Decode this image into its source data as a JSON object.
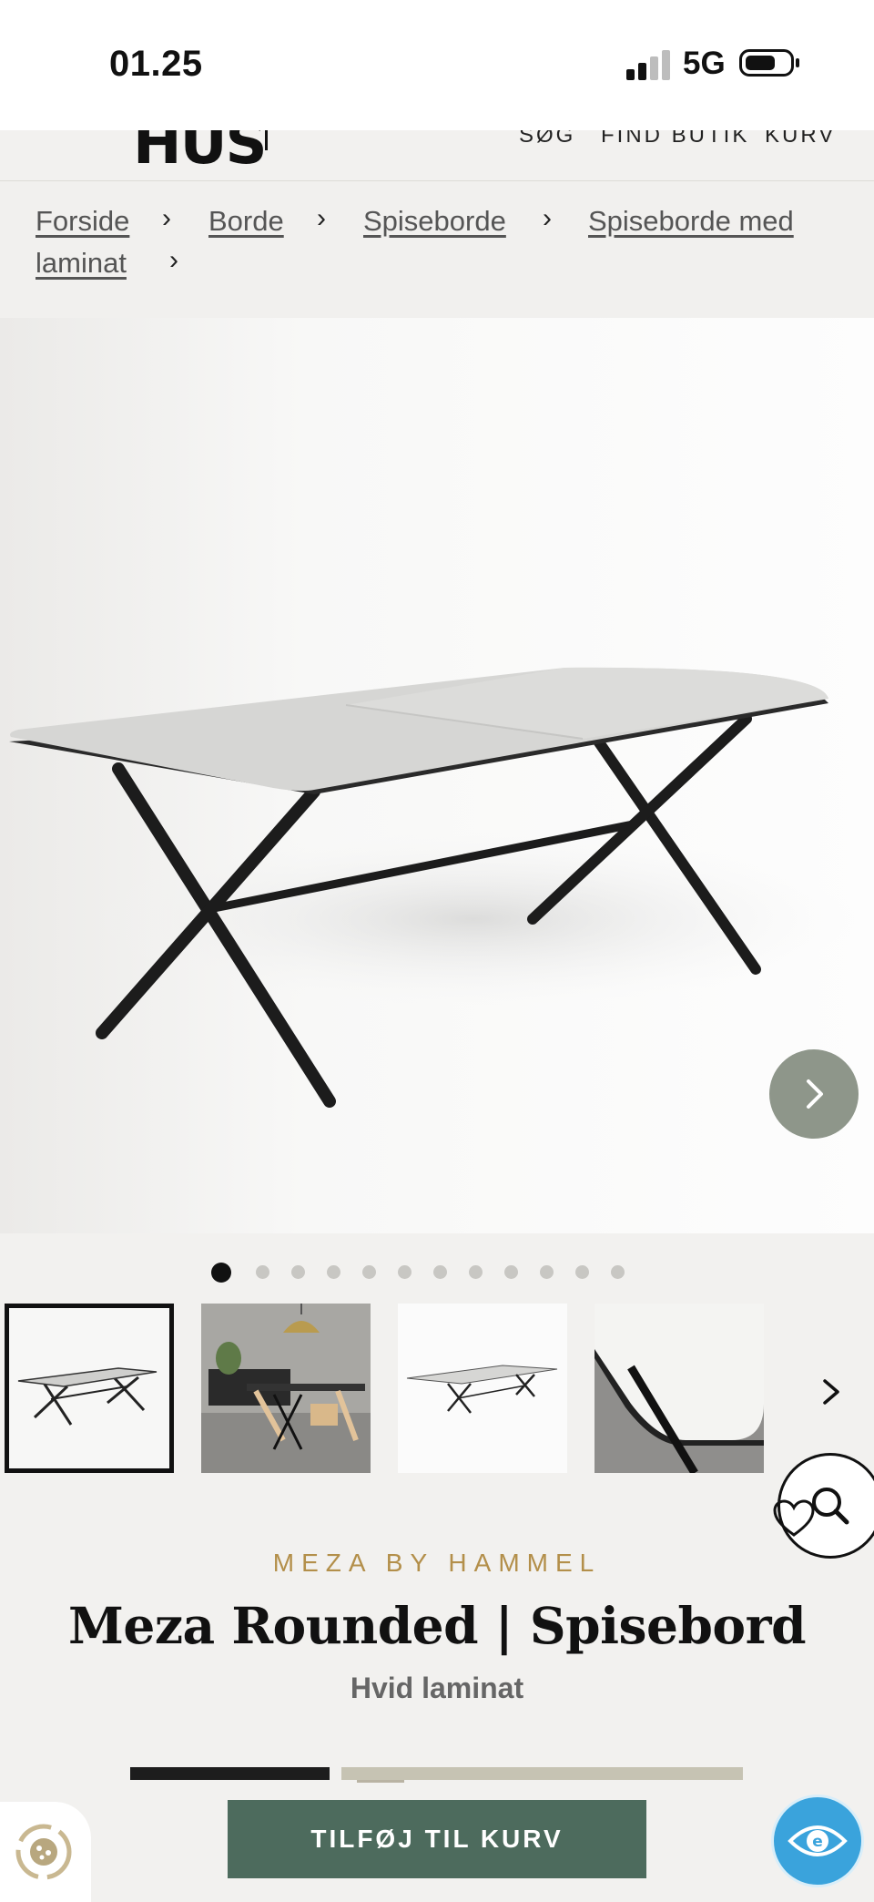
{
  "status_bar": {
    "time": "01.25",
    "network": "5G"
  },
  "header": {
    "logo": "HUS",
    "links": [
      "SØG",
      "FIND BUTIK",
      "KURV"
    ]
  },
  "breadcrumb": [
    "Forside",
    "Borde",
    "Spiseborde",
    "Spiseborde med laminat"
  ],
  "breadcrumb_lines": {
    "line2": "laminat",
    "line1_last": "Spiseborde med"
  },
  "gallery": {
    "image_count": 12,
    "active_index": 0,
    "thumbnails": [
      "table-front-white",
      "dining-room-scene",
      "table-extended",
      "corner-closeup"
    ]
  },
  "product": {
    "brand": "MEZA BY HAMMEL",
    "title": "Meza Rounded | Spisebord",
    "variant": "Hvid laminat",
    "swatch_colors": [
      "#1d1d1d",
      "#c6c3b3"
    ]
  },
  "actions": {
    "add_to_cart": "TILFØJ TIL KURV"
  },
  "colors": {
    "accent_green": "#4d6b5d",
    "brand_gold": "#b38f4a",
    "arrow_button": "#8e968a",
    "accessibility_blue": "#3aa3dc"
  }
}
